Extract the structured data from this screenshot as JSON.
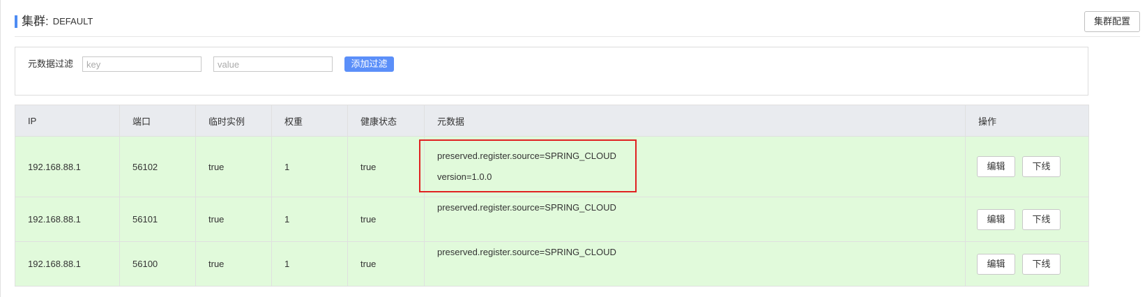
{
  "header": {
    "title": "集群:",
    "cluster_name": "DEFAULT",
    "config_button": "集群配置"
  },
  "filter": {
    "label": "元数据过滤",
    "key_placeholder": "key",
    "value_placeholder": "value",
    "add_button": "添加过滤"
  },
  "table": {
    "columns": [
      "IP",
      "端口",
      "临时实例",
      "权重",
      "健康状态",
      "元数据",
      "操作"
    ],
    "rows": [
      {
        "ip": "192.168.88.1",
        "port": "56102",
        "ephemeral": "true",
        "weight": "1",
        "healthy": "true",
        "metadata": [
          "preserved.register.source=SPRING_CLOUD",
          "version=1.0.0"
        ],
        "edit": "编辑",
        "offline": "下线"
      },
      {
        "ip": "192.168.88.1",
        "port": "56101",
        "ephemeral": "true",
        "weight": "1",
        "healthy": "true",
        "metadata": [
          "preserved.register.source=SPRING_CLOUD"
        ],
        "edit": "编辑",
        "offline": "下线"
      },
      {
        "ip": "192.168.88.1",
        "port": "56100",
        "ephemeral": "true",
        "weight": "1",
        "healthy": "true",
        "metadata": [
          "preserved.register.source=SPRING_CLOUD"
        ],
        "edit": "编辑",
        "offline": "下线"
      }
    ]
  },
  "colors": {
    "accent": "#5b8ff9",
    "row_background": "#e1fadb",
    "header_background": "#e9ebef",
    "highlight": "#e02020"
  }
}
